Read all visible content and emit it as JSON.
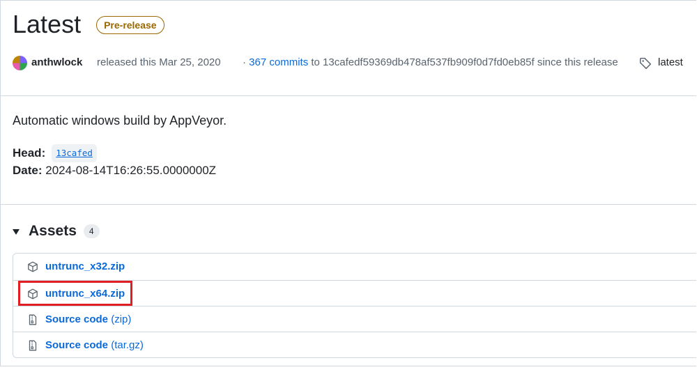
{
  "release": {
    "title": "Latest",
    "badge": "Pre-release",
    "author": "anthwlock",
    "released_text": "released this Mar 25, 2020",
    "separator": "·",
    "commits_link": "367 commits",
    "commits_to_text": "to 13cafedf59369db478af537fb909f0d7fd0eb85f since this release",
    "tag_label": "latest"
  },
  "body": {
    "description": "Automatic windows build by AppVeyor.",
    "head_label": "Head:",
    "head_sha": "13cafed",
    "date_label": "Date:",
    "date_value": "2024-08-14T16:26:55.0000000Z"
  },
  "assets": {
    "title": "Assets",
    "count": "4",
    "items": [
      {
        "name": "untrunc_x32.zip",
        "suffix": "",
        "icon": "package-icon"
      },
      {
        "name": "untrunc_x64.zip",
        "suffix": "",
        "icon": "package-icon"
      },
      {
        "name": "Source code",
        "suffix": "(zip)",
        "icon": "file-zip-icon"
      },
      {
        "name": "Source code",
        "suffix": "(tar.gz)",
        "icon": "file-zip-icon"
      }
    ]
  },
  "colors": {
    "link": "#0969da",
    "prerelease": "#9a6700",
    "highlight": "#e01e23",
    "border": "#d0d7de"
  }
}
